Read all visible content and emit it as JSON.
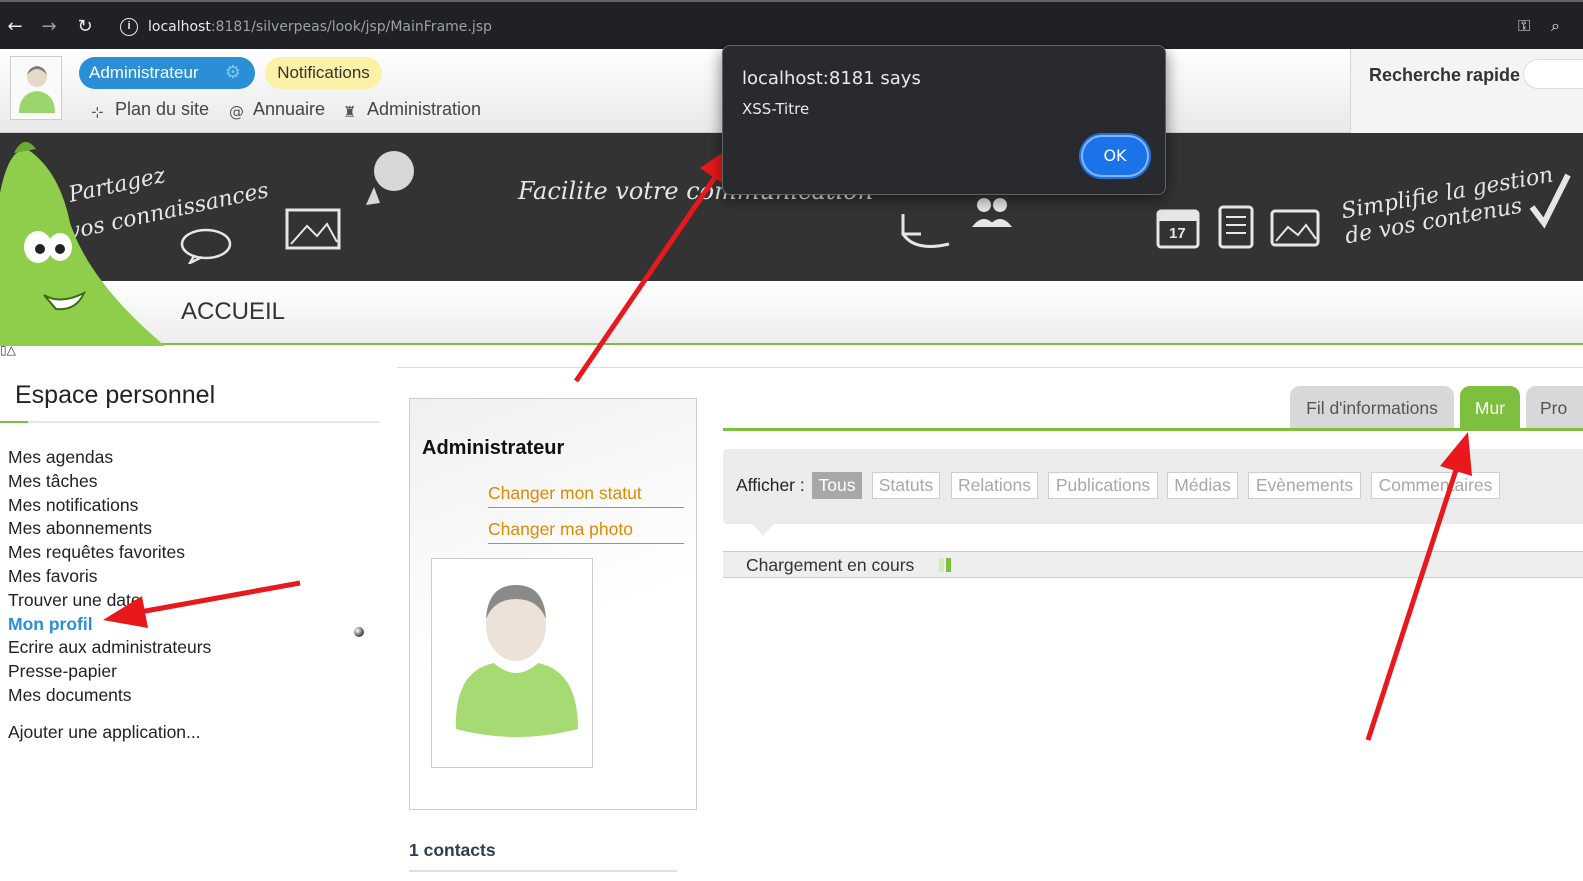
{
  "browser": {
    "url_host": "localhost",
    "url_rest": ":8181/silverpeas/look/jsp/MainFrame.jsp"
  },
  "header": {
    "user_pill": "Administrateur",
    "notifications_pill": "Notifications",
    "links": [
      "Plan du site",
      "Annuaire",
      "Administration"
    ],
    "quick_search_label": "Recherche rapide"
  },
  "banner": {
    "slogan_left_1": "Partagez",
    "slogan_left_2": "vos connaissances",
    "slogan_mid": "Facilite votre communication",
    "slogan_right_1": "Simplifie la gestion",
    "slogan_right_2": "de vos contenus",
    "calendar_day": "17"
  },
  "page": {
    "title": "ACCUEIL"
  },
  "sidebar": {
    "title": "Espace personnel",
    "items": [
      "Mes agendas",
      "Mes tâches",
      "Mes notifications",
      "Mes abonnements",
      "Mes requêtes favorites",
      "Mes favoris",
      "Trouver une date",
      "Mon profil",
      "Ecrire aux administrateurs",
      "Presse-papier",
      "Mes documents"
    ],
    "active_item": "Mon profil",
    "add_app": "Ajouter une application..."
  },
  "profile": {
    "name": "Administrateur",
    "change_status": "Changer mon statut",
    "change_photo": "Changer ma photo",
    "contacts": "1 contacts"
  },
  "tabs": [
    {
      "label": "Fil d'informations",
      "active": false
    },
    {
      "label": "Mur",
      "active": true
    },
    {
      "label": "Pro",
      "active": false
    }
  ],
  "filter": {
    "label": "Afficher :",
    "options": [
      "Tous",
      "Statuts",
      "Relations",
      "Publications",
      "Médias",
      "Evènements",
      "Commentaires"
    ],
    "selected": "Tous"
  },
  "loading_text": "Chargement en cours",
  "dialog": {
    "title": "localhost:8181 says",
    "message": "XSS-Titre",
    "ok_label": "OK"
  },
  "colors": {
    "accent_green": "#7dbf3f",
    "accent_blue": "#2a8fd6",
    "link_orange": "#e08a00",
    "annotation_red": "#e8191c"
  }
}
